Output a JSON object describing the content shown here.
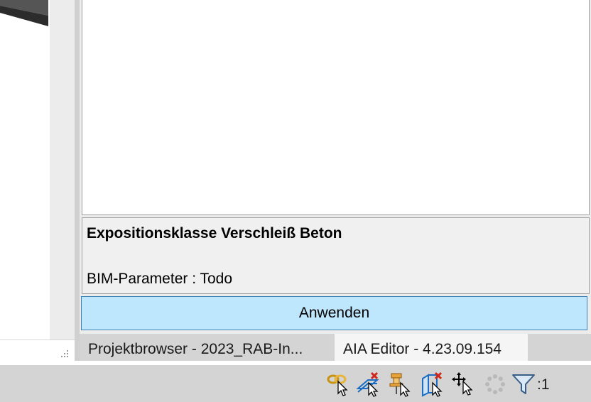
{
  "description_panel": {
    "title": "Expositionsklasse Verschleiß Beton",
    "text": "BIM-Parameter : Todo"
  },
  "apply_button": {
    "label": "Anwenden"
  },
  "tabs": [
    {
      "label": "Projektbrowser - 2023_RAB-In..."
    },
    {
      "label": "AIA Editor - 4.23.09.154"
    }
  ],
  "status_bar": {
    "icons": [
      "select-links-icon",
      "select-underlay-icon",
      "select-pinned-icon",
      "select-by-face-icon",
      "drag-on-selection-icon",
      "background-process-icon",
      "filter-icon"
    ],
    "filter_count": ":1"
  },
  "colors": {
    "accent_button": "#bee6fd",
    "accent_button_border": "#3c7fb1",
    "icon_red": "#d0271d",
    "icon_blue": "#1b6ec2",
    "icon_orange": "#e8a33a"
  }
}
